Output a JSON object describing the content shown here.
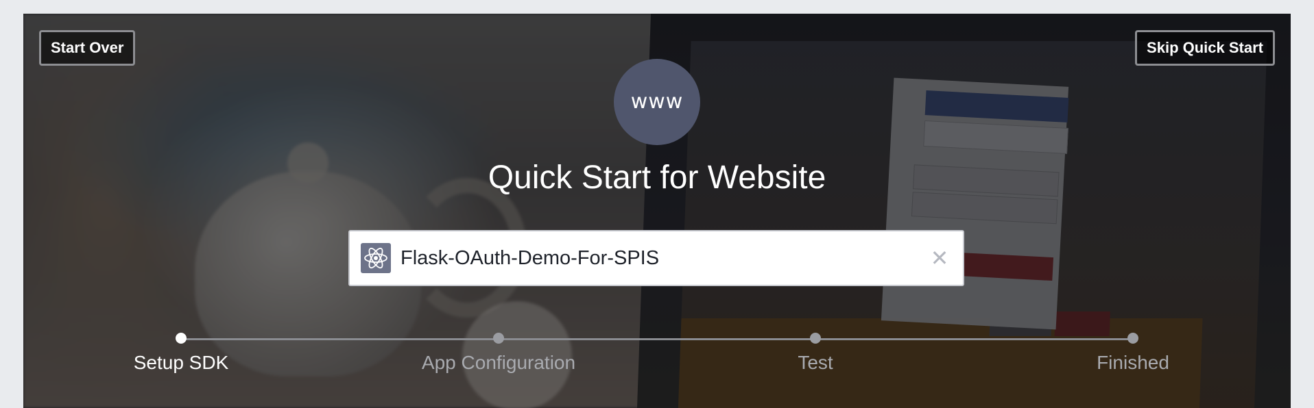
{
  "header": {
    "start_over_label": "Start Over",
    "skip_label": "Skip Quick Start"
  },
  "hero": {
    "icon_text": "www",
    "title": "Quick Start for Website"
  },
  "app_field": {
    "value": "Flask-OAuth-Demo-For-SPIS",
    "icon": "atom-icon",
    "clear_icon": "close-icon"
  },
  "steps": [
    {
      "label": "Setup SDK",
      "active": true
    },
    {
      "label": "App Configuration",
      "active": false
    },
    {
      "label": "Test",
      "active": false
    },
    {
      "label": "Finished",
      "active": false
    }
  ],
  "colors": {
    "page_background": "#e9ebee",
    "icon_circle": "#50566d",
    "step_inactive": "#a9abb0",
    "step_active": "#ffffff"
  }
}
